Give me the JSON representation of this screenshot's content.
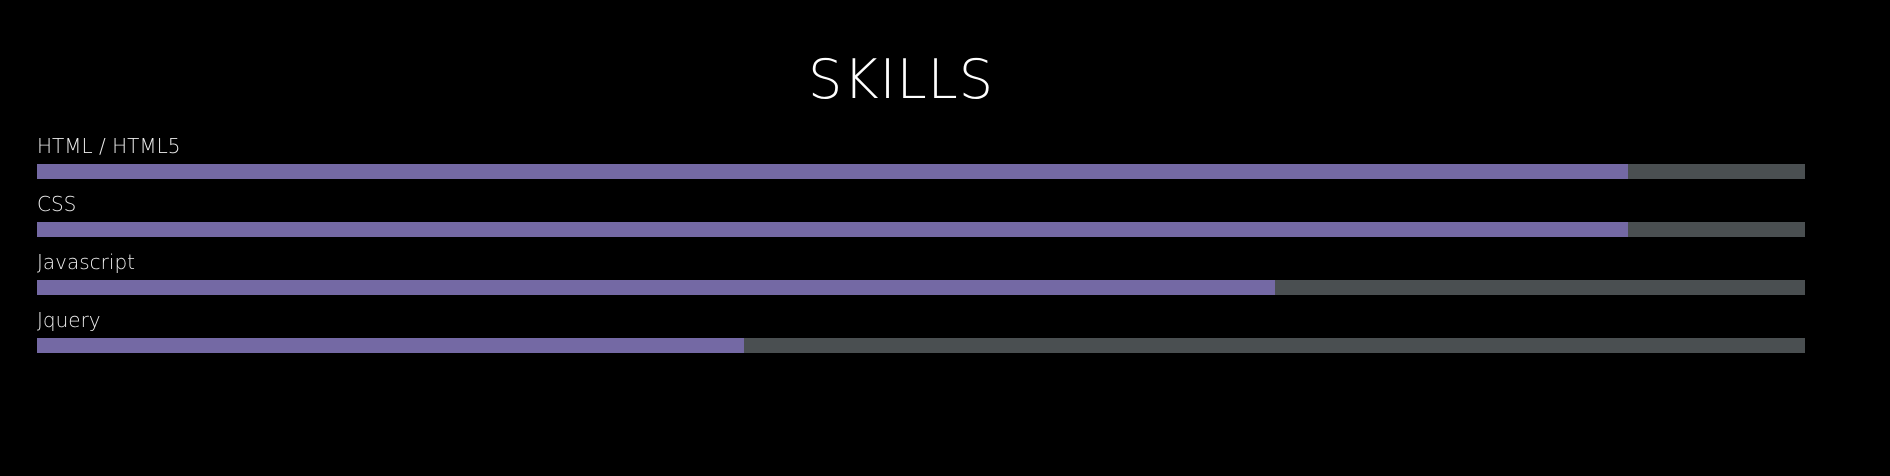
{
  "section": {
    "title": "SKILLS"
  },
  "colors": {
    "background": "#000000",
    "fill": "#7469a4",
    "track": "#4a4f51",
    "text": "#ffffff"
  },
  "skills": [
    {
      "label": "HTML / HTML5",
      "level": 0.9
    },
    {
      "label": "CSS",
      "level": 0.9
    },
    {
      "label": "Javascript",
      "level": 0.7
    },
    {
      "label": "Jquery",
      "level": 0.4
    }
  ]
}
